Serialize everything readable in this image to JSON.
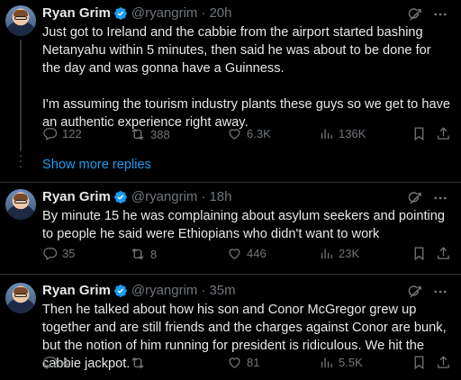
{
  "colors": {
    "background": "#000000",
    "text": "#e7e9ea",
    "muted": "#71767b",
    "link": "#1d9bf0",
    "verified": "#1d9bf0"
  },
  "show_more": "Show more replies",
  "tweets": [
    {
      "name": "Ryan Grim",
      "handle": "@ryangrim",
      "dot": "·",
      "time": "20h",
      "text": "Just got to Ireland and the cabbie from the airport started bashing Netanyahu within 5 minutes, then said he was about to be done for the day and was gonna have a Guinness.\n\nI'm assuming the tourism industry plants these guys so we get to have an authentic experience right away.",
      "replies": "122",
      "reposts": "388",
      "likes": "6.3K",
      "views": "136K"
    },
    {
      "name": "Ryan Grim",
      "handle": "@ryangrim",
      "dot": "·",
      "time": "18h",
      "text": "By minute 15 he was complaining about asylum seekers and pointing to people he said were Ethiopians who didn't want to work",
      "replies": "35",
      "reposts": "8",
      "likes": "446",
      "views": "23K"
    },
    {
      "name": "Ryan Grim",
      "handle": "@ryangrim",
      "dot": "·",
      "time": "35m",
      "text": "Then he talked about how his son and Conor McGregor grew up together and are still friends and the charges against Conor are bunk, but the notion of him running for president is ridiculous. We hit the cabbie jackpot.",
      "replies": "4",
      "reposts": "",
      "likes": "81",
      "views": "5.5K"
    }
  ]
}
